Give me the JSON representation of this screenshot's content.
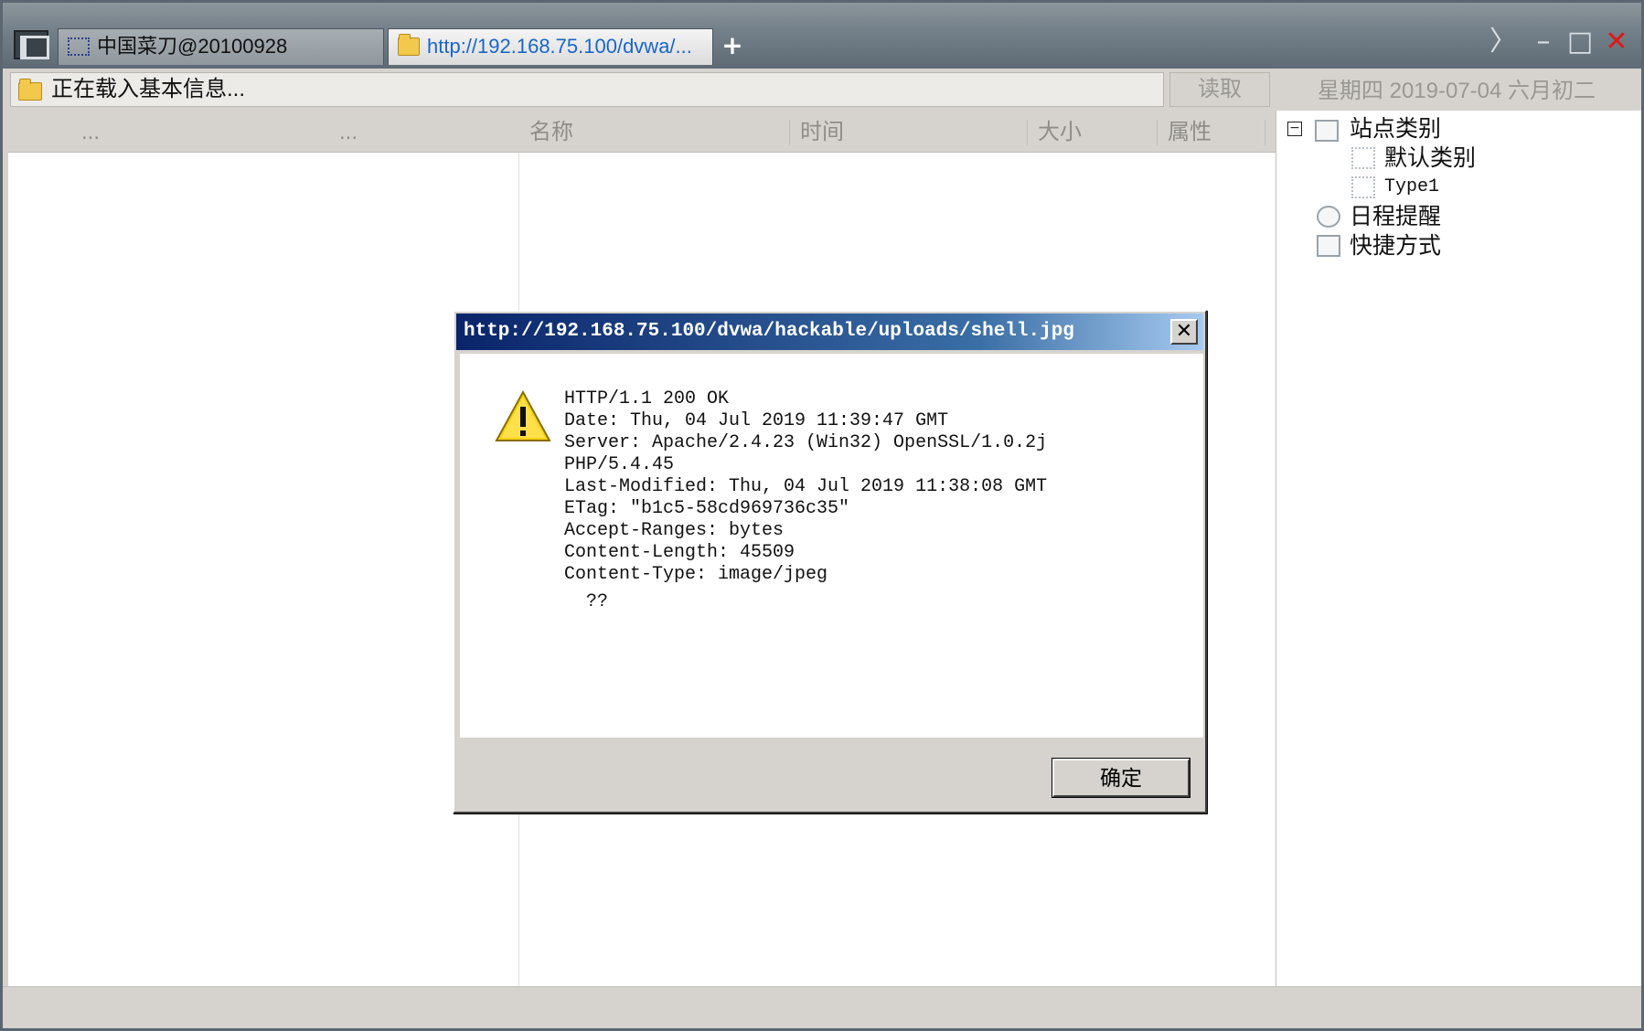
{
  "tabs": [
    {
      "label": "中国菜刀@20100928",
      "icon": "page-icon",
      "active": false
    },
    {
      "label": "http://192.168.75.100/dvwa/...",
      "icon": "folder-icon",
      "active": true
    }
  ],
  "add_tab_label": "+",
  "window_controls": {
    "forward": "〉",
    "minimize": "–",
    "maximize": "□",
    "close": "✕",
    "close_color": "#e01818"
  },
  "address_bar": {
    "value": "正在载入基本信息..."
  },
  "read_button": "读取",
  "date_text": "星期四 2019-07-04 六月初二",
  "columns": [
    "...",
    "...",
    "名称",
    "时间",
    "大小",
    "属性"
  ],
  "tree": {
    "root": {
      "label": "站点类别",
      "expander": "−"
    },
    "children": [
      "默认类别",
      "Type1"
    ],
    "items": [
      "日程提醒",
      "快捷方式"
    ]
  },
  "dialog": {
    "title": "http://192.168.75.100/dvwa/hackable/uploads/shell.jpg",
    "close_label": "✕",
    "lines": [
      "HTTP/1.1 200 OK",
      "Date: Thu, 04 Jul 2019 11:39:47 GMT",
      "Server: Apache/2.4.23 (Win32) OpenSSL/1.0.2j",
      "PHP/5.4.45",
      "Last-Modified: Thu, 04 Jul 2019 11:38:08 GMT",
      "ETag: \"b1c5-58cd969736c35\"",
      "Accept-Ranges: bytes",
      "Content-Length: 45509",
      "Content-Type: image/jpeg"
    ],
    "extra": "??",
    "ok_label": "确定",
    "icon": "warning-icon"
  }
}
